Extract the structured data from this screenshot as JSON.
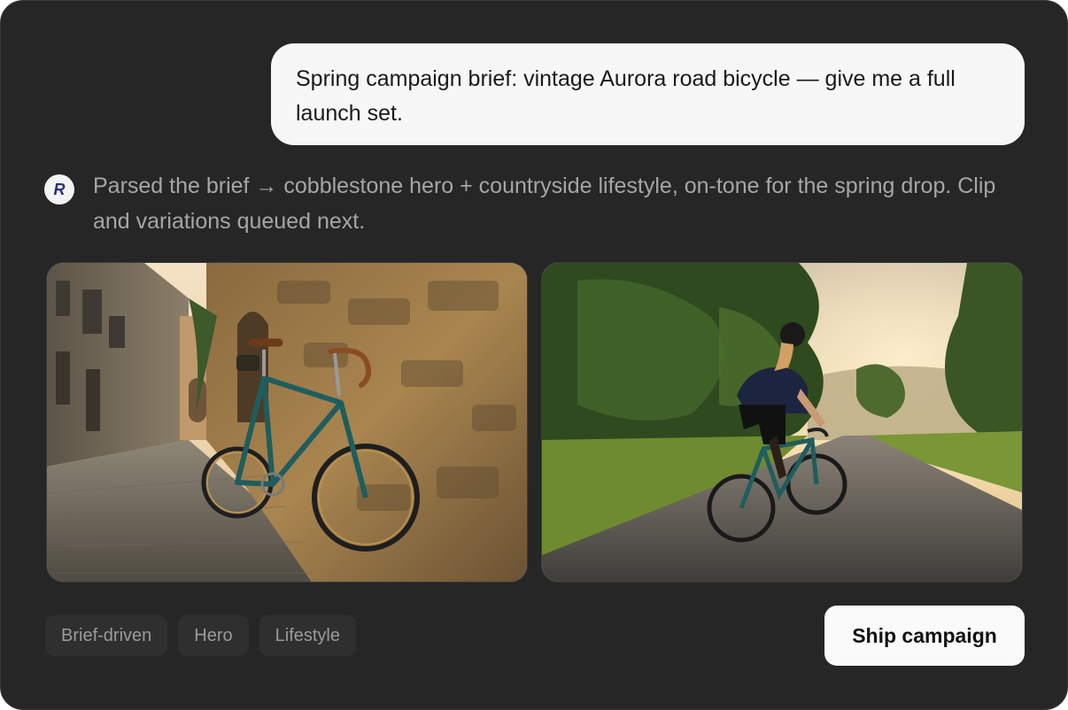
{
  "conversation": {
    "user_message": "Spring campaign brief: vintage Aurora road bicycle — give me a full launch set.",
    "assistant_avatar_letter": "R",
    "assistant_message": "Parsed the brief → cobblestone hero + countryside lifestyle, on-tone for the spring drop. Clip and variations queued next."
  },
  "images": [
    {
      "subject": "vintage teal road bicycle leaning against stone wall on cobblestone street"
    },
    {
      "subject": "cyclist riding teal road bicycle on countryside road at sunset"
    }
  ],
  "tags": [
    "Brief-driven",
    "Hero",
    "Lifestyle"
  ],
  "actions": {
    "ship_label": "Ship campaign"
  },
  "colors": {
    "panel_bg": "#262626",
    "bubble_bg": "#f7f7f7",
    "bike_teal": "#1f5d5e",
    "avatar_letter": "#2b2f7a"
  }
}
